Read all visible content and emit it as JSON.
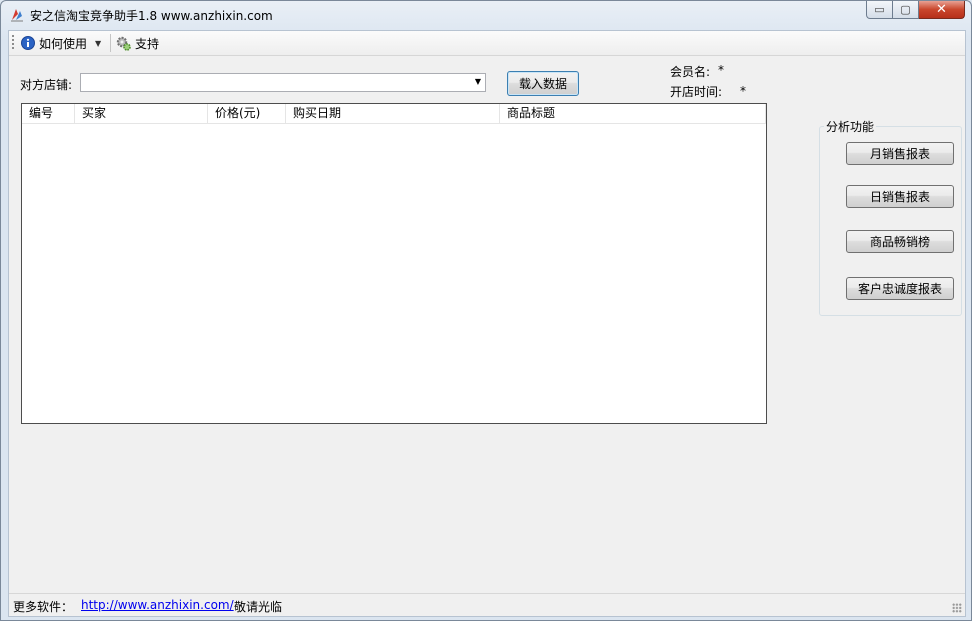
{
  "window": {
    "title": "安之信淘宝竞争助手1.8  www.anzhixin.com",
    "min_glyph": "▭",
    "max_glyph": "▢",
    "close_glyph": "✕"
  },
  "toolbar": {
    "help_label": "如何使用",
    "support_label": "支持",
    "dropdown_glyph": "▼"
  },
  "form": {
    "shop_label": "对方店铺:",
    "shop_value": "",
    "combo_glyph": "▼",
    "load_button": "载入数据",
    "member_label": "会员名:",
    "member_value": "*",
    "open_time_label": "开店时间:",
    "open_time_value": "*"
  },
  "table": {
    "columns": [
      "编号",
      "买家",
      "价格(元)",
      "购买日期",
      "商品标题"
    ],
    "rows": []
  },
  "analysis": {
    "title": "分析功能",
    "buttons": [
      "月销售报表",
      "日销售报表",
      "商品畅销榜",
      "客户忠诚度报表"
    ]
  },
  "status": {
    "more_label": "更多软件：",
    "link": "http://www.anzhixin.com/",
    "suffix": "敬请光临"
  },
  "colors": {
    "accent": "#3c7fb1",
    "link": "#0000ee",
    "close": "#c9462c"
  }
}
